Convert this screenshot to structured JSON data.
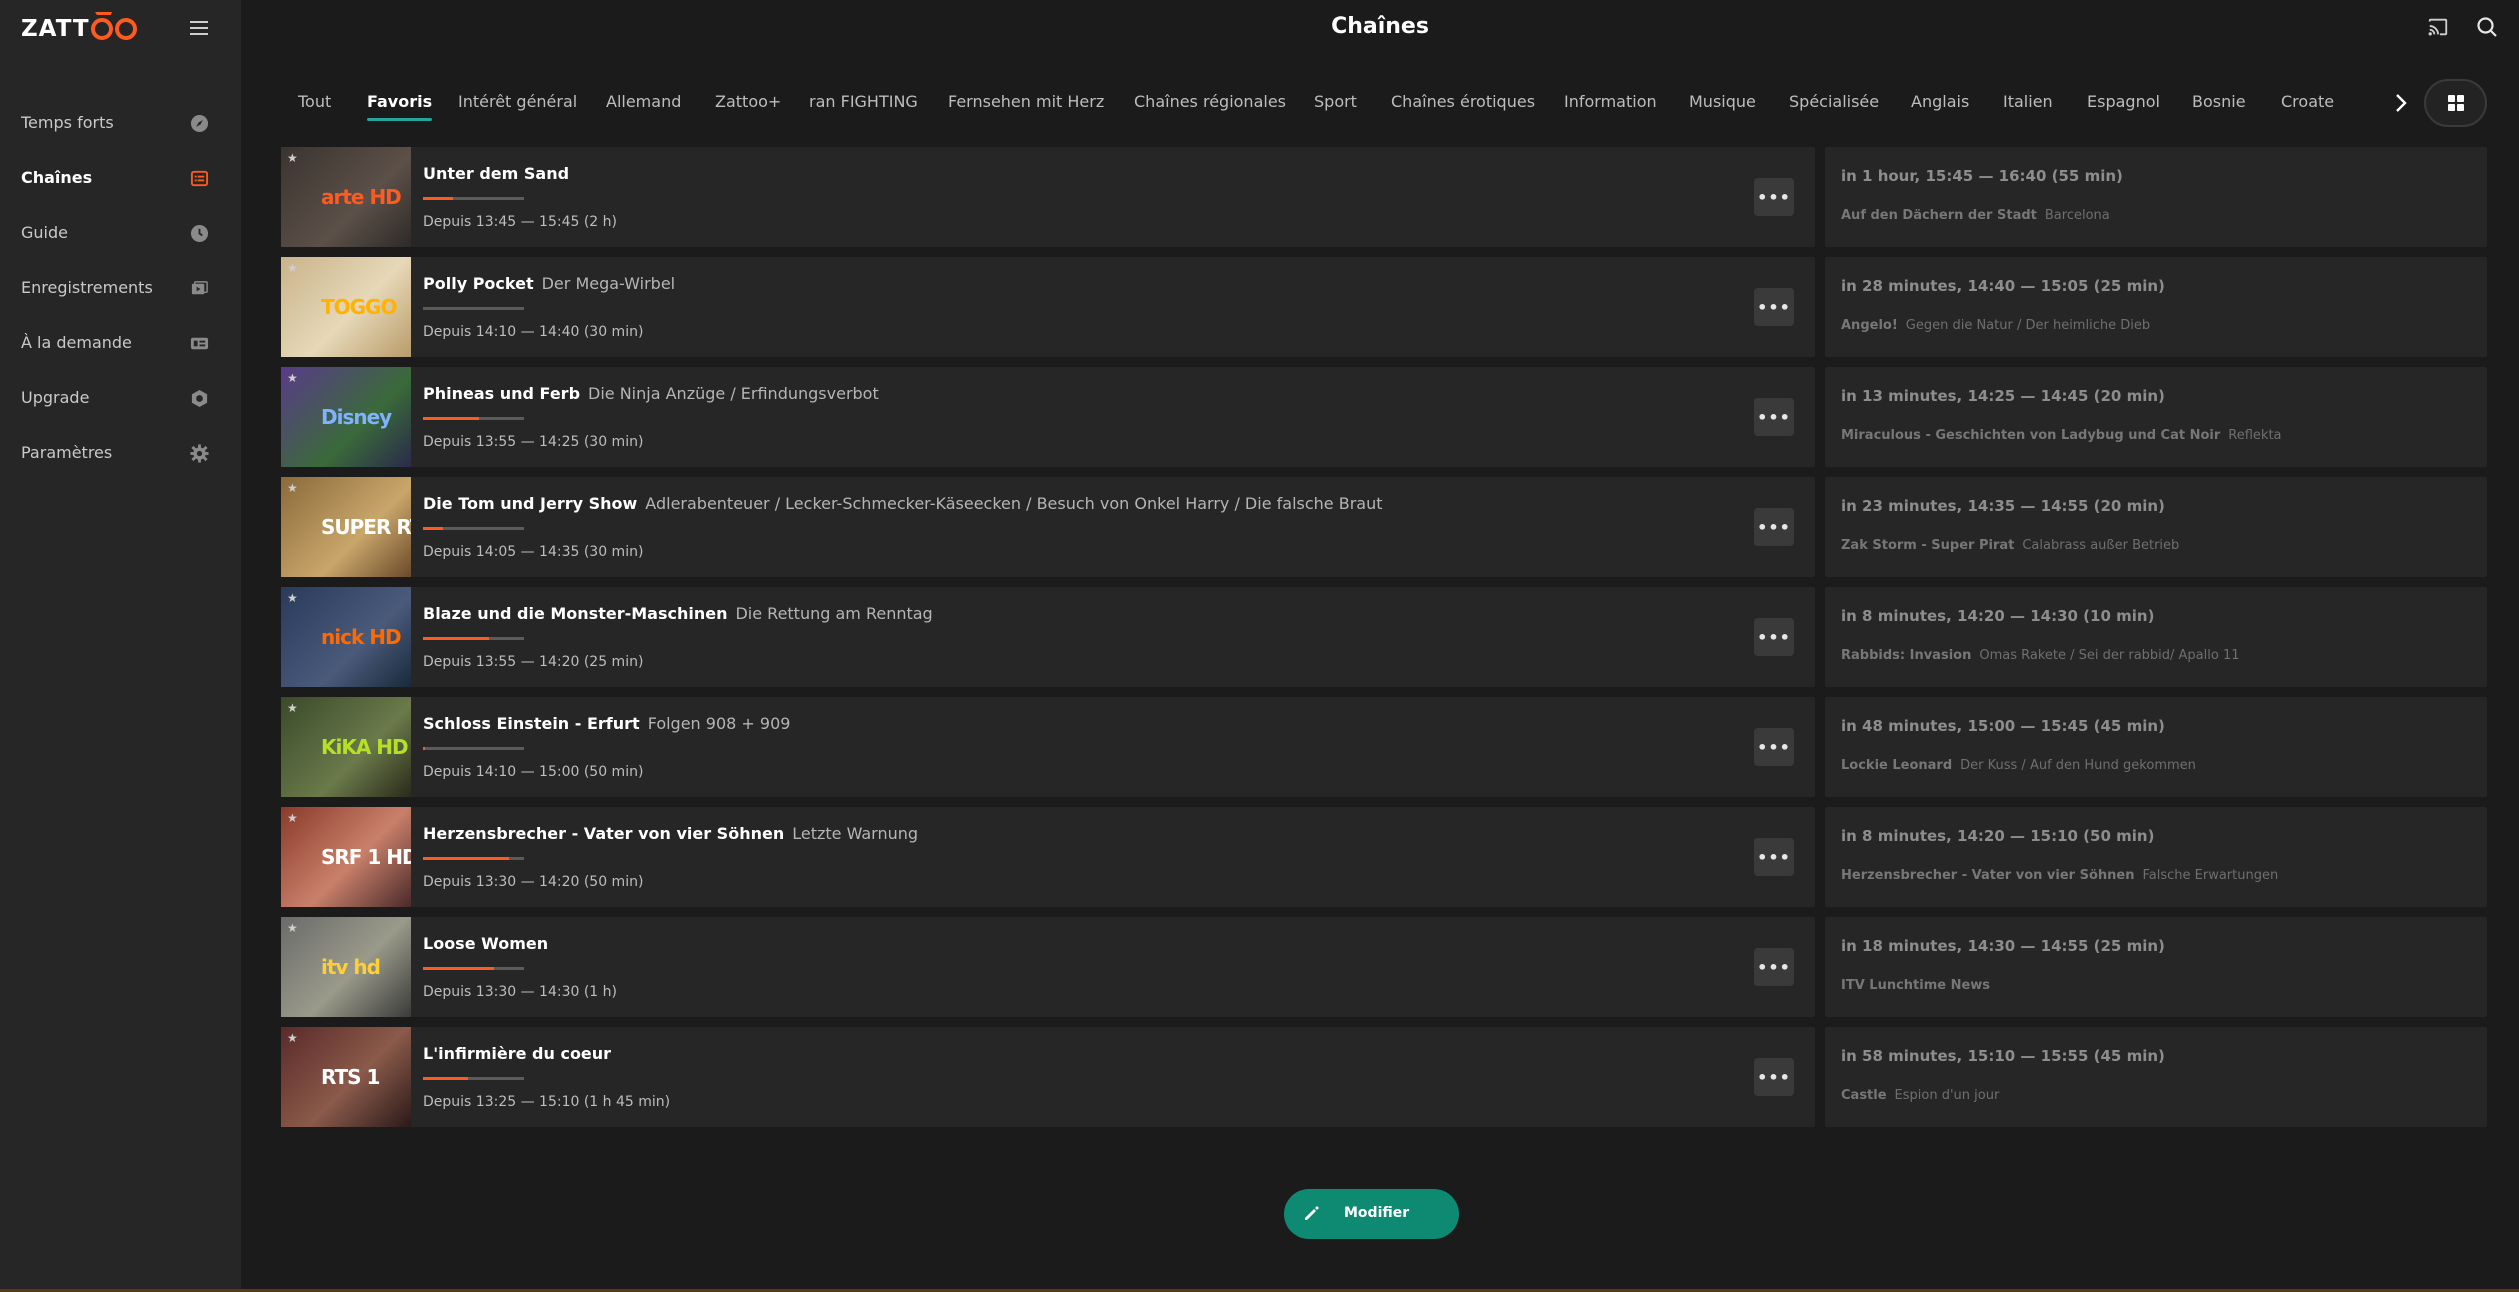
{
  "app": {
    "logo_text": "ZATTOO",
    "title": "Chaînes"
  },
  "colors": {
    "accent": "#ff5a1f",
    "teal": "#0e8a73",
    "bg": "#1b1b1b",
    "sidebar": "#262626"
  },
  "sidebar": {
    "items": [
      {
        "label": "Temps forts",
        "icon": "compass-icon"
      },
      {
        "label": "Chaînes",
        "icon": "channels-icon",
        "active": true
      },
      {
        "label": "Guide",
        "icon": "clock-icon"
      },
      {
        "label": "Enregistrements",
        "icon": "recordings-icon"
      },
      {
        "label": "À la demande",
        "icon": "on-demand-icon"
      },
      {
        "label": "Upgrade",
        "icon": "upgrade-icon"
      },
      {
        "label": "Paramètres",
        "icon": "gear-icon"
      }
    ]
  },
  "tabs": [
    {
      "label": "Tout"
    },
    {
      "label": "Favoris",
      "active": true
    },
    {
      "label": "Intérêt général"
    },
    {
      "label": "Allemand"
    },
    {
      "label": "Zattoo+"
    },
    {
      "label": "ran FIGHTING"
    },
    {
      "label": "Fernsehen mit Herz"
    },
    {
      "label": "Chaînes régionales"
    },
    {
      "label": "Sport"
    },
    {
      "label": "Chaînes érotiques"
    },
    {
      "label": "Information"
    },
    {
      "label": "Musique"
    },
    {
      "label": "Spécialisée"
    },
    {
      "label": "Anglais"
    },
    {
      "label": "Italien"
    },
    {
      "label": "Espagnol"
    },
    {
      "label": "Bosnie"
    },
    {
      "label": "Croate"
    }
  ],
  "channels": [
    {
      "logo": "arte HD",
      "logo_color": "#ff5a1f",
      "title": "Unter dem Sand",
      "episode": "",
      "time": "Depuis 13:45 — 15:45 (2 h)",
      "progress": 0.3,
      "next_time": "in 1 hour, 15:45 — 16:40 (55 min)",
      "next_title": "Auf den Dächern der Stadt",
      "next_episode": "Barcelona"
    },
    {
      "logo": "TOGGO",
      "logo_color": "#ffb300",
      "title": "Polly Pocket",
      "episode": "Der Mega-Wirbel",
      "time": "Depuis 14:10 — 14:40 (30 min)",
      "progress": 0.0,
      "next_time": "in 28 minutes, 14:40 — 15:05 (25 min)",
      "next_title": "Angelo!",
      "next_episode": "Gegen die Natur / Der heimliche Dieb"
    },
    {
      "logo": "Disney",
      "logo_color": "#7fb2ff",
      "title": "Phineas und Ferb",
      "episode": "Die Ninja Anzüge / Erfindungsverbot",
      "time": "Depuis 13:55 — 14:25 (30 min)",
      "progress": 0.55,
      "next_time": "in 13 minutes, 14:25 — 14:45 (20 min)",
      "next_title": "Miraculous - Geschichten von Ladybug und Cat Noir",
      "next_episode": "Reflekta"
    },
    {
      "logo": "SUPER RTL",
      "logo_color": "#ffffff",
      "title": "Die Tom und Jerry Show",
      "episode": "Adlerabenteuer / Lecker-Schmecker-Käseecken / Besuch von Onkel Harry / Die falsche Braut",
      "time": "Depuis 14:05 — 14:35 (30 min)",
      "progress": 0.2,
      "next_time": "in 23 minutes, 14:35 — 14:55 (20 min)",
      "next_title": "Zak Storm - Super Pirat",
      "next_episode": "Calabrass außer Betrieb"
    },
    {
      "logo": "nick HD",
      "logo_color": "#ff6a00",
      "title": "Blaze und die Monster-Maschinen",
      "episode": "Die Rettung am Renntag",
      "time": "Depuis 13:55 — 14:20 (25 min)",
      "progress": 0.65,
      "next_time": "in 8 minutes, 14:20 — 14:30 (10 min)",
      "next_title": "Rabbids: Invasion",
      "next_episode": "Omas Rakete / Sei der rabbid/ Apallo 11"
    },
    {
      "logo": "KiKA HD",
      "logo_color": "#b6e026",
      "title": "Schloss Einstein - Erfurt",
      "episode": "Folgen 908 + 909",
      "time": "Depuis 14:10 — 15:00 (50 min)",
      "progress": 0.02,
      "next_time": "in 48 minutes, 15:00 — 15:45 (45 min)",
      "next_title": "Lockie Leonard",
      "next_episode": "Der Kuss / Auf den Hund gekommen"
    },
    {
      "logo": "SRF 1 HD",
      "logo_color": "#ffffff",
      "title": "Herzensbrecher - Vater von vier Söhnen",
      "episode": "Letzte Warnung",
      "time": "Depuis 13:30 — 14:20 (50 min)",
      "progress": 0.85,
      "next_time": "in 8 minutes, 14:20 — 15:10 (50 min)",
      "next_title": "Herzensbrecher - Vater von vier Söhnen",
      "next_episode": "Falsche Erwartungen"
    },
    {
      "logo": "itv hd",
      "logo_color": "#ffcf33",
      "title": "Loose Women",
      "episode": "",
      "time": "Depuis 13:30 — 14:30 (1 h)",
      "progress": 0.7,
      "next_time": "in 18 minutes, 14:30 — 14:55 (25 min)",
      "next_title": "ITV Lunchtime News",
      "next_episode": ""
    },
    {
      "logo": "RTS 1",
      "logo_color": "#ffffff",
      "title": "L'infirmière du coeur",
      "episode": "",
      "time": "Depuis 13:25 — 15:10 (1 h 45 min)",
      "progress": 0.45,
      "next_time": "in 58 minutes, 15:10 — 15:55 (45 min)",
      "next_title": "Castle",
      "next_episode": "Espion d'un jour"
    }
  ],
  "footer": {
    "modify_label": "Modifier"
  }
}
